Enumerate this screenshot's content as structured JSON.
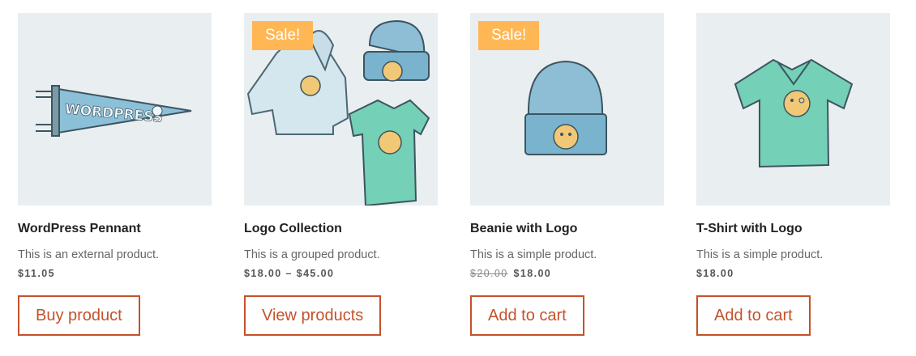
{
  "products": [
    {
      "title": "WordPress Pennant",
      "description": "This is an external product.",
      "price": "$11.05",
      "button": "Buy product",
      "image_icon": "pennant-image"
    },
    {
      "title": "Logo Collection",
      "description": "This is a grouped product.",
      "price": "$18.00 – $45.00",
      "button": "View products",
      "sale_badge": "Sale!",
      "image_icon": "logo-collection-image"
    },
    {
      "title": "Beanie with Logo",
      "description": "This is a simple product.",
      "regular_price": "$20.00",
      "sale_price": "$18.00",
      "button": "Add to cart",
      "sale_badge": "Sale!",
      "image_icon": "beanie-image"
    },
    {
      "title": "T-Shirt with Logo",
      "description": "This is a simple product.",
      "price": "$18.00",
      "button": "Add to cart",
      "image_icon": "tshirt-image"
    }
  ],
  "colors": {
    "accent": "#c4522a",
    "sale_badge": "#ffb755",
    "image_bg": "#e9eef1"
  }
}
